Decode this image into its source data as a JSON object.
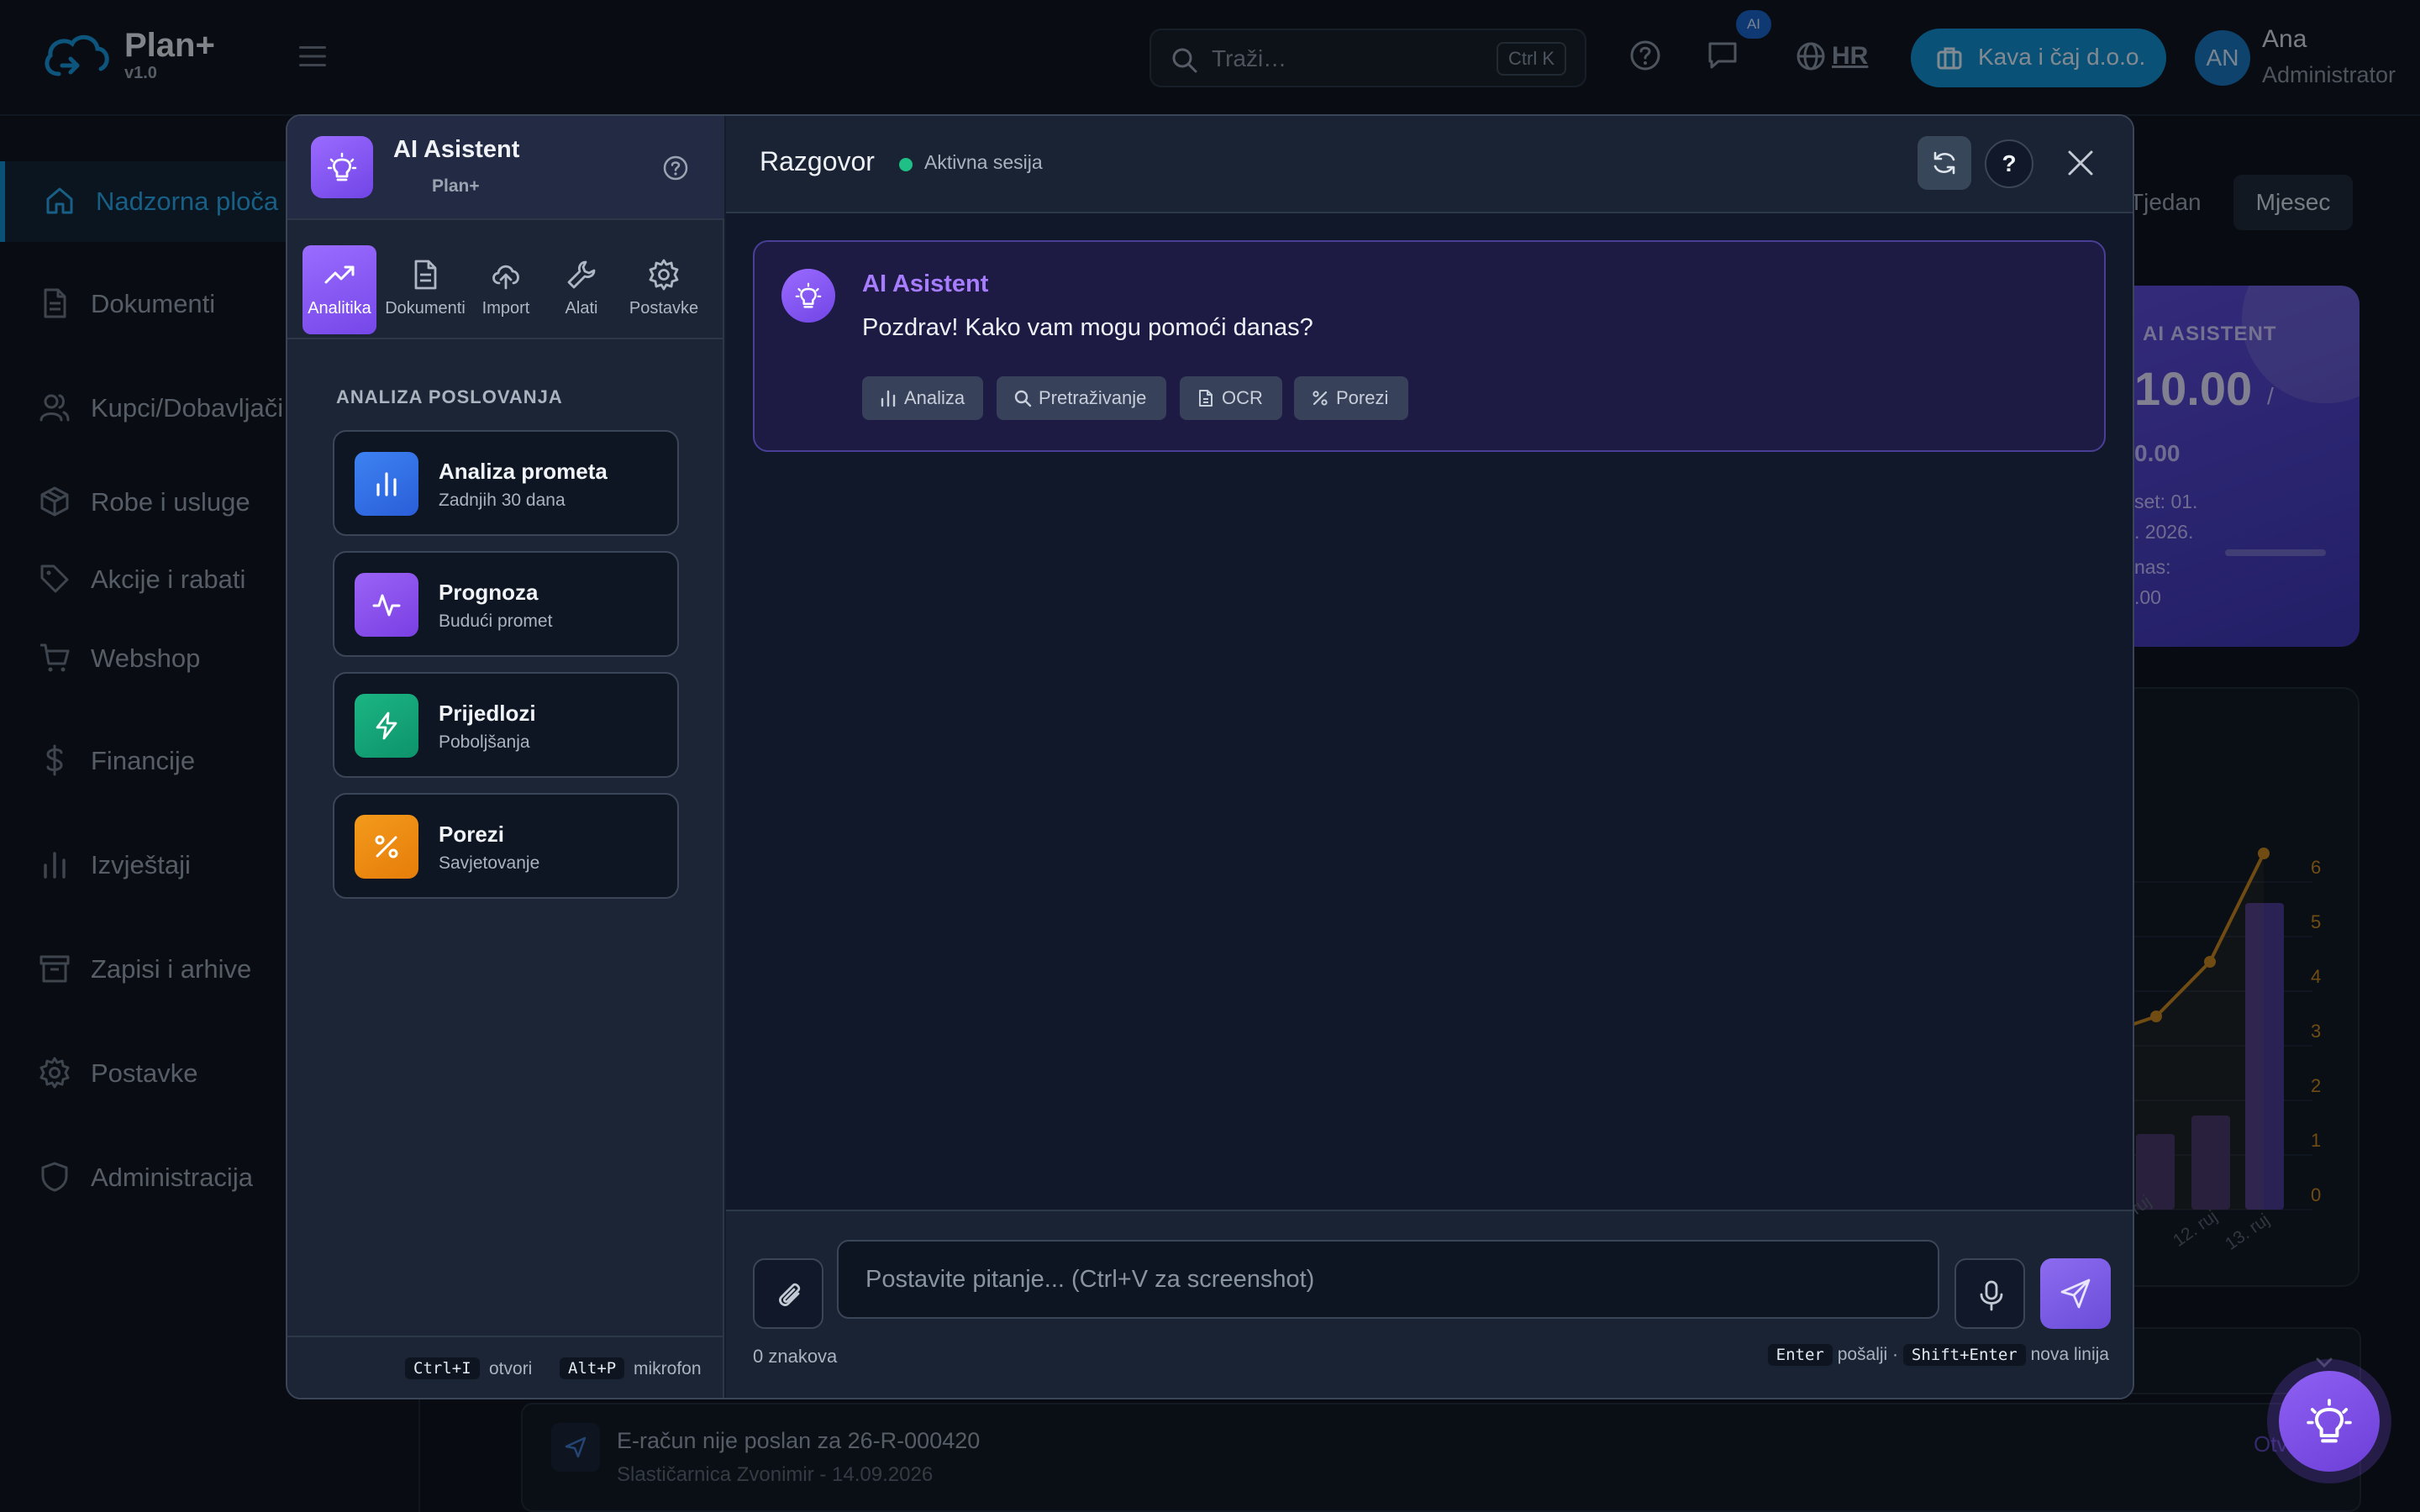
{
  "app": {
    "brand": "Plan+",
    "version": "v1.0"
  },
  "topbar": {
    "search_placeholder": "Traži…",
    "search_shortcut": "Ctrl K",
    "ai_badge": "AI",
    "language": "HR",
    "company": "Kava i čaj d.o.o.",
    "user": {
      "initials": "AN",
      "name": "Ana",
      "role": "Administrator"
    }
  },
  "sidebar": {
    "items": [
      {
        "label": "Nadzorna ploča",
        "icon": "home-icon",
        "active": true
      },
      {
        "label": "Dokumenti",
        "icon": "document-icon"
      },
      {
        "label": "Kupci/Dobavljači",
        "icon": "users-icon"
      },
      {
        "label": "Robe i usluge",
        "icon": "box-icon"
      },
      {
        "label": "Akcije i rabati",
        "icon": "tag-icon"
      },
      {
        "label": "Webshop",
        "icon": "cart-icon"
      },
      {
        "label": "Financije",
        "icon": "dollar-icon"
      },
      {
        "label": "Izvještaji",
        "icon": "bar-chart-icon"
      },
      {
        "label": "Zapisi i arhive",
        "icon": "archive-icon"
      },
      {
        "label": "Postavke",
        "icon": "gear-icon"
      },
      {
        "label": "Administracija",
        "icon": "shield-icon"
      }
    ]
  },
  "background": {
    "period_tabs": [
      "Tjedan",
      "Mjesec"
    ],
    "ai_card": {
      "title": "AI ASISTENT",
      "value": "10.00",
      "sep": "/",
      "sub": "0.00",
      "line1": "set: 01.",
      "line2": ". 2026.",
      "line3": "nas:",
      "line4": ".00"
    },
    "chart_y_ticks": [
      "6",
      "5",
      "4",
      "3",
      "2",
      "1",
      "0"
    ],
    "chart_x_ticks": [
      "ruj",
      "12. ruj",
      "13. ruj"
    ],
    "notification": {
      "title": "E-račun nije poslan za 26-R-000420",
      "subtitle": "Slastičarnica Zvonimir - 14.09.2026",
      "action": "Otv"
    }
  },
  "modal": {
    "title": "AI Asistent",
    "subtitle": "Plan+",
    "tabs": [
      {
        "label": "Analitika",
        "icon": "trend-icon",
        "active": true
      },
      {
        "label": "Dokumenti",
        "icon": "document-icon"
      },
      {
        "label": "Import",
        "icon": "upload-icon"
      },
      {
        "label": "Alati",
        "icon": "wrench-icon"
      },
      {
        "label": "Postavke",
        "icon": "gear-icon"
      }
    ],
    "section_title": "ANALIZA POSLOVANJA",
    "cards": [
      {
        "title": "Analiza prometa",
        "subtitle": "Zadnjih 30 dana",
        "color": "#2f6de6",
        "icon": "bar-chart-icon"
      },
      {
        "title": "Prognoza",
        "subtitle": "Budući promet",
        "color": "#8b4ef0",
        "icon": "activity-icon"
      },
      {
        "title": "Prijedlozi",
        "subtitle": "Poboljšanja",
        "color": "#14a374",
        "icon": "bolt-icon"
      },
      {
        "title": "Porezi",
        "subtitle": "Savjetovanje",
        "color": "#ef8a0e",
        "icon": "percent-icon"
      }
    ],
    "footer": {
      "shortcut1": "Ctrl+I",
      "shortcut1_label": "otvori",
      "shortcut2": "Alt+P",
      "shortcut2_label": "mikrofon"
    }
  },
  "chat": {
    "title": "Razgovor",
    "session": "Aktivna sesija",
    "help_label": "?",
    "message": {
      "sender": "AI Asistent",
      "text": "Pozdrav! Kako vam mogu pomoći danas?",
      "chips": [
        "Analiza",
        "Pretraživanje",
        "OCR",
        "Porezi"
      ]
    },
    "input_placeholder": "Postavite pitanje... (Ctrl+V za screenshot)",
    "char_count": "0 znakova",
    "hint_enter": "Enter",
    "hint_enter_label": "pošalji ·",
    "hint_shift": "Shift+Enter",
    "hint_shift_label": "nova linija"
  },
  "colors": {
    "accent": "#0f8fd1",
    "ai_purple": "#7c4de6",
    "success": "#1fbf86"
  }
}
